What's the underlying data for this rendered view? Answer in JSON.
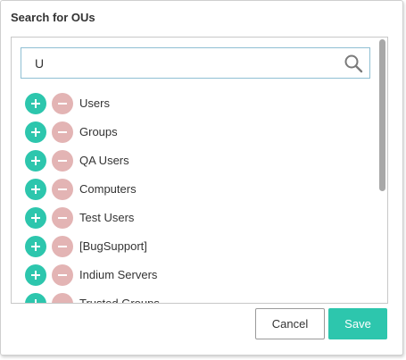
{
  "dialog": {
    "title": "Search for OUs",
    "cancel_label": "Cancel",
    "save_label": "Save"
  },
  "search": {
    "value": "U",
    "icon": "search-icon"
  },
  "ou_list": {
    "items": [
      {
        "label": "Users"
      },
      {
        "label": "Groups"
      },
      {
        "label": "QA Users"
      },
      {
        "label": "Computers"
      },
      {
        "label": "Test Users"
      },
      {
        "label": "[BugSupport]"
      },
      {
        "label": "Indium Servers"
      },
      {
        "label": "Trusted Groups"
      }
    ],
    "add_icon": "plus-icon",
    "remove_icon": "minus-icon"
  },
  "colors": {
    "accent": "#2dc6ad",
    "remove": "#e3b4b4",
    "search_border": "#8fbfd3"
  }
}
